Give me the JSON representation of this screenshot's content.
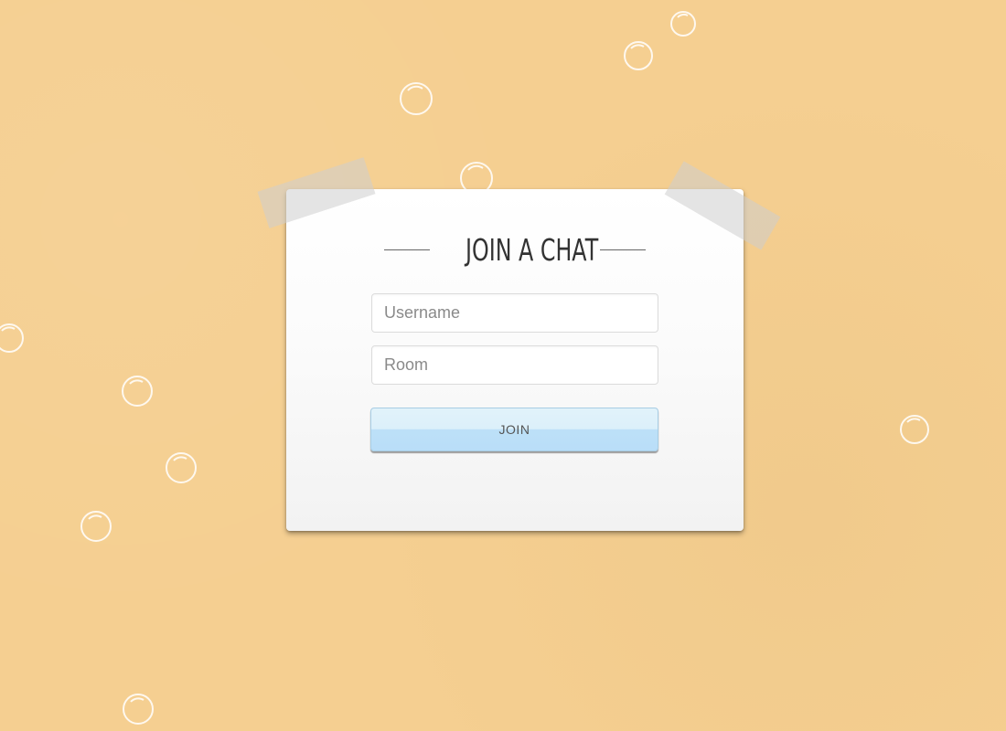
{
  "background": {
    "color": "#f5cf91",
    "bubble_icon": "bubble-outline"
  },
  "card": {
    "title": "JOIN A CHAT",
    "username_field": {
      "placeholder": "Username",
      "value": ""
    },
    "room_field": {
      "placeholder": "Room",
      "value": ""
    },
    "join_button_label": "JOIN"
  },
  "colors": {
    "button_top": "#e1f2fa",
    "button_bottom": "#b9def8",
    "title_text": "#333333"
  }
}
